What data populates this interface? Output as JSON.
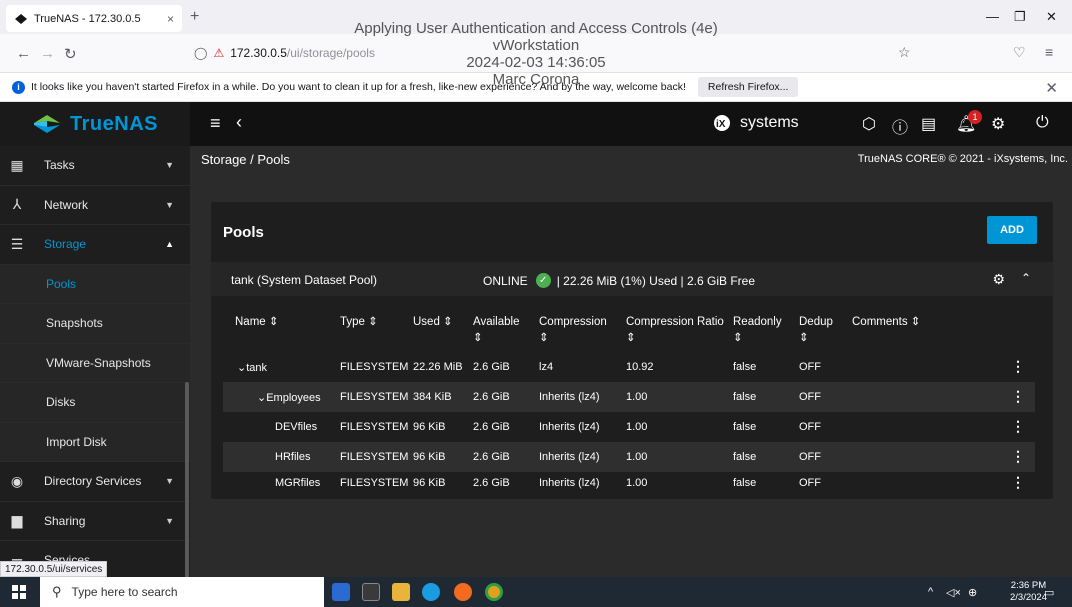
{
  "browser": {
    "tab_title": "TrueNAS - 172.30.0.5",
    "tab_close": "×",
    "new_tab": "+",
    "url_host": "172.30.0.5",
    "url_path": "/ui/storage/pools",
    "notification_text": "It looks like you haven't started Firefox in a while. Do you want to clean it up for a fresh, like-new experience? And by the way, welcome back!",
    "refresh_label": "Refresh Firefox...",
    "status_url": "172.30.0.5/ui/services"
  },
  "watermark": {
    "line1": "Applying User Authentication and Access Controls (4e)",
    "line2": "vWorkstation",
    "line3": "2024-02-03 14:36:05",
    "line4": "Marc Corona"
  },
  "topbar": {
    "brand": "TrueNAS",
    "vendor": "systems"
  },
  "sidebar": {
    "items": [
      {
        "label": "Tasks",
        "icon": "calendar-icon"
      },
      {
        "label": "Network",
        "icon": "network-icon"
      },
      {
        "label": "Storage",
        "icon": "storage-icon"
      },
      {
        "label": "Pools"
      },
      {
        "label": "Snapshots"
      },
      {
        "label": "VMware-Snapshots"
      },
      {
        "label": "Disks"
      },
      {
        "label": "Import Disk"
      },
      {
        "label": "Directory Services",
        "icon": "directory-icon"
      },
      {
        "label": "Sharing",
        "icon": "folder-icon"
      },
      {
        "label": "Services",
        "icon": "services-icon"
      }
    ]
  },
  "main": {
    "breadcrumb": "Storage / Pools",
    "copyright": "TrueNAS CORE® © 2021 - iXsystems, Inc.",
    "card_title": "Pools",
    "add_label": "ADD",
    "pool": {
      "name": "tank  (System Dataset Pool)",
      "status": "ONLINE",
      "usage": "| 22.26 MiB (1%) Used | 2.6 GiB Free"
    },
    "columns": [
      "Name ⇕",
      "Type ⇕",
      "Used ⇕",
      "Available ⇕",
      "Compression ⇕",
      "Compression Ratio ⇕",
      "Readonly ⇕",
      "Dedup ⇕",
      "Comments ⇕"
    ],
    "rows": [
      {
        "name": "⌄tank",
        "type": "FILESYSTEM",
        "used": "22.26 MiB",
        "available": "2.6 GiB",
        "compression": "lz4",
        "ratio": "10.92",
        "readonly": "false",
        "dedup": "OFF"
      },
      {
        "name": "⌄Employees",
        "type": "FILESYSTEM",
        "used": "384 KiB",
        "available": "2.6 GiB",
        "compression": "Inherits (lz4)",
        "ratio": "1.00",
        "readonly": "false",
        "dedup": "OFF"
      },
      {
        "name": "DEVfiles",
        "type": "FILESYSTEM",
        "used": "96 KiB",
        "available": "2.6 GiB",
        "compression": "Inherits (lz4)",
        "ratio": "1.00",
        "readonly": "false",
        "dedup": "OFF"
      },
      {
        "name": "HRfiles",
        "type": "FILESYSTEM",
        "used": "96 KiB",
        "available": "2.6 GiB",
        "compression": "Inherits (lz4)",
        "ratio": "1.00",
        "readonly": "false",
        "dedup": "OFF"
      },
      {
        "name": "MGRfiles",
        "type": "FILESYSTEM",
        "used": "96 KiB",
        "available": "2.6 GiB",
        "compression": "Inherits (lz4)",
        "ratio": "1.00",
        "readonly": "false",
        "dedup": "OFF"
      }
    ]
  },
  "taskbar": {
    "search_placeholder": "Type here to search",
    "time": "2:36 PM",
    "date": "2/3/2024"
  },
  "colors": {
    "accent": "#0095d5",
    "online": "#4caf50",
    "alert": "#d42121"
  }
}
